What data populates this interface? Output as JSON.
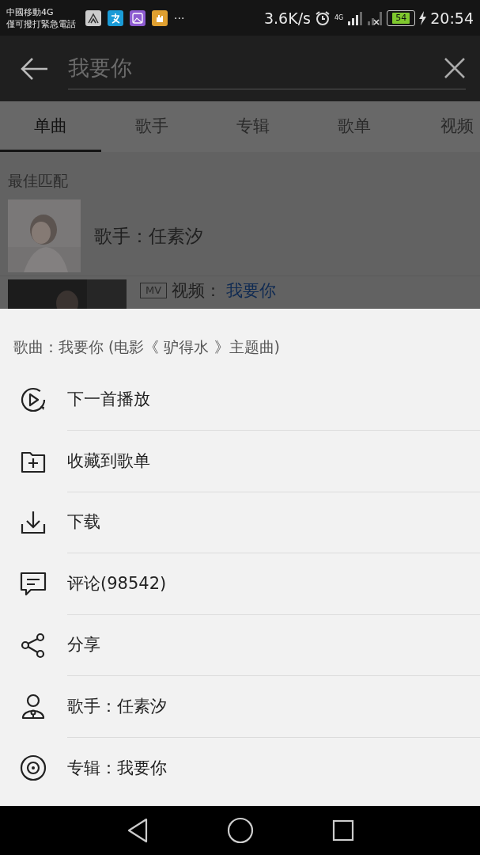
{
  "status_bar": {
    "carrier": "中國移動4G",
    "carrier_note": "僅可撥打緊急電話",
    "more": "···",
    "speed": "3.6K/s",
    "network": "4G",
    "battery": "54",
    "time": "20:54"
  },
  "search": {
    "value": "我要你"
  },
  "tabs": [
    {
      "label": "单曲",
      "selected": true
    },
    {
      "label": "歌手",
      "selected": false
    },
    {
      "label": "专辑",
      "selected": false
    },
    {
      "label": "歌单",
      "selected": false
    },
    {
      "label": "视频",
      "selected": false
    }
  ],
  "best_match": {
    "heading": "最佳匹配",
    "artist": "歌手：任素汐",
    "video_badge": "MV",
    "video_label": "视频：",
    "video_title": "我要你"
  },
  "sheet": {
    "title": "歌曲：我要你 (电影《 驴得水 》主题曲)",
    "items": [
      {
        "kind": "play-next",
        "label": "下一首播放"
      },
      {
        "kind": "add-playlist",
        "label": "收藏到歌单"
      },
      {
        "kind": "download",
        "label": "下载"
      },
      {
        "kind": "comment",
        "label": "评论(98542)"
      },
      {
        "kind": "share",
        "label": "分享"
      },
      {
        "kind": "artist",
        "label": "歌手：任素汐"
      },
      {
        "kind": "album",
        "label": "专辑：我要你"
      }
    ]
  }
}
